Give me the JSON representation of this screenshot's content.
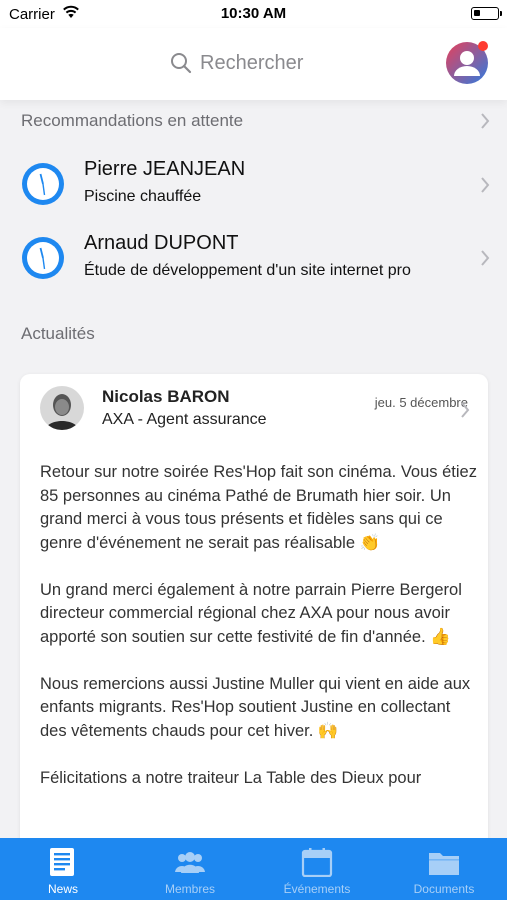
{
  "status_bar": {
    "carrier": "Carrier",
    "time": "10:30 AM"
  },
  "header": {
    "search_placeholder": "Rechercher"
  },
  "recommendations": {
    "title": "Recommandations en attente",
    "items": [
      {
        "name": "Pierre JEANJEAN",
        "subtitle": "Piscine chauffée"
      },
      {
        "name": "Arnaud DUPONT",
        "subtitle": "Étude de développement d'un site internet pro"
      }
    ]
  },
  "news": {
    "title": "Actualités",
    "post": {
      "author": "Nicolas BARON",
      "role": "AXA - Agent assurance",
      "date": "jeu. 5 décembre",
      "paragraphs": [
        "Retour sur notre soirée Res'Hop fait son cinéma. Vous étiez 85 personnes au cinéma Pathé de Brumath hier soir. Un grand merci à vous tous présents et fidèles sans qui ce genre d'événement ne serait pas réalisable 👏",
        "Un grand merci également à notre parrain Pierre Bergerol directeur commercial régional chez AXA pour nous avoir apporté son soutien sur cette festivité de fin d'année. 👍",
        "Nous remercions aussi Justine Muller qui vient en aide aux enfants migrants. Res'Hop soutient Justine en collectant des vêtements chauds pour cet hiver. 🙌",
        "Félicitations a notre traiteur La Table des Dieux pour"
      ]
    }
  },
  "tabs": [
    {
      "label": "News",
      "icon": "news-icon",
      "active": true
    },
    {
      "label": "Membres",
      "icon": "members-icon",
      "active": false
    },
    {
      "label": "Événements",
      "icon": "calendar-icon",
      "active": false
    },
    {
      "label": "Documents",
      "icon": "folder-icon",
      "active": false
    }
  ],
  "colors": {
    "accent": "#1e88f0",
    "badge": "#ff3b30",
    "avatar_gradient_start": "#e8405a",
    "avatar_gradient_end": "#2f7be0"
  }
}
